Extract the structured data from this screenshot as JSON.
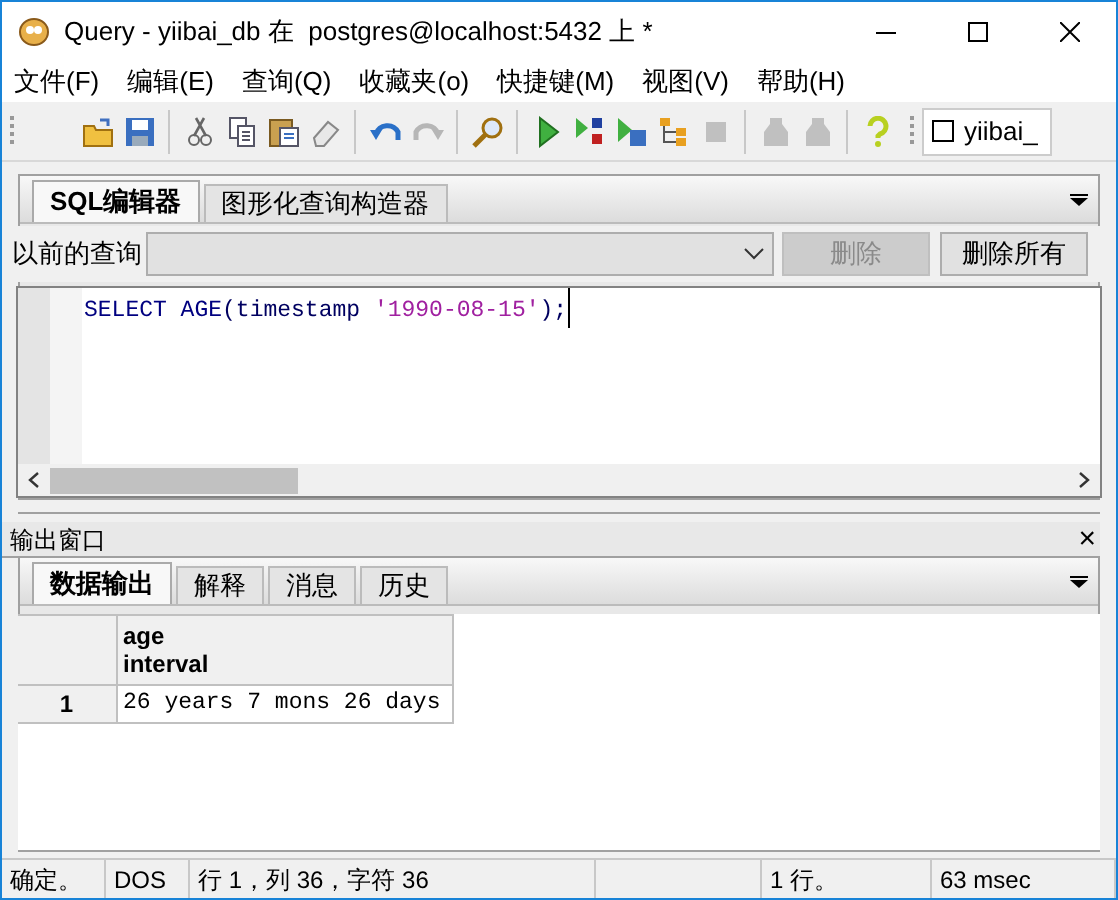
{
  "window": {
    "title": "Query - yiibai_db 在  postgres@localhost:5432 上 *"
  },
  "menu": [
    "文件(F)",
    "编辑(E)",
    "查询(Q)",
    "收藏夹(o)",
    "快捷键(M)",
    "视图(V)",
    "帮助(H)"
  ],
  "toolbar": [
    {
      "kind": "open",
      "disabled": false
    },
    {
      "kind": "save",
      "disabled": false
    },
    {
      "kind": "sep"
    },
    {
      "kind": "cut",
      "disabled": false
    },
    {
      "kind": "copy",
      "disabled": false
    },
    {
      "kind": "paste",
      "disabled": false
    },
    {
      "kind": "eraser",
      "disabled": false
    },
    {
      "kind": "sep"
    },
    {
      "kind": "undo",
      "disabled": false
    },
    {
      "kind": "redo",
      "disabled": true
    },
    {
      "kind": "sep"
    },
    {
      "kind": "find",
      "disabled": false
    },
    {
      "kind": "sep"
    },
    {
      "kind": "run",
      "disabled": false
    },
    {
      "kind": "explain",
      "disabled": false
    },
    {
      "kind": "runsave",
      "disabled": false
    },
    {
      "kind": "tree",
      "disabled": false
    },
    {
      "kind": "stop",
      "disabled": true
    },
    {
      "kind": "sep"
    },
    {
      "kind": "jar",
      "disabled": true
    },
    {
      "kind": "jar",
      "disabled": true
    },
    {
      "kind": "sep"
    },
    {
      "kind": "help",
      "disabled": false
    }
  ],
  "db_selector": {
    "checked": false,
    "label": "yiibai_"
  },
  "editor_tabs": [
    {
      "label": "SQL编辑器",
      "selected": true
    },
    {
      "label": "图形化查询构造器",
      "selected": false
    }
  ],
  "previous_queries": {
    "label": "以前的查询",
    "delete_button": {
      "label": "删除",
      "disabled": true
    },
    "delete_all_button": {
      "label": "删除所有",
      "disabled": false
    }
  },
  "sql_tokens": [
    {
      "text": "SELECT AGE",
      "kind": "keyword"
    },
    {
      "text": "(timestamp ",
      "kind": "plain"
    },
    {
      "text": "'1990-08-15'",
      "kind": "string"
    },
    {
      "text": ");",
      "kind": "plain"
    }
  ],
  "output": {
    "title": "输出窗口",
    "close": "×",
    "tabs": [
      {
        "label": "数据输出",
        "selected": true
      },
      {
        "label": "解释",
        "selected": false
      },
      {
        "label": "消息",
        "selected": false
      },
      {
        "label": "历史",
        "selected": false
      }
    ],
    "columns": [
      {
        "name": "age",
        "type": "interval"
      }
    ],
    "rows": [
      {
        "number": "1",
        "cells": [
          "26 years 7 mons 26 days"
        ]
      }
    ]
  },
  "status_bar": [
    "确定。",
    "DOS",
    "行 1，列 36，字符 36",
    "1 行。",
    "63 msec"
  ]
}
